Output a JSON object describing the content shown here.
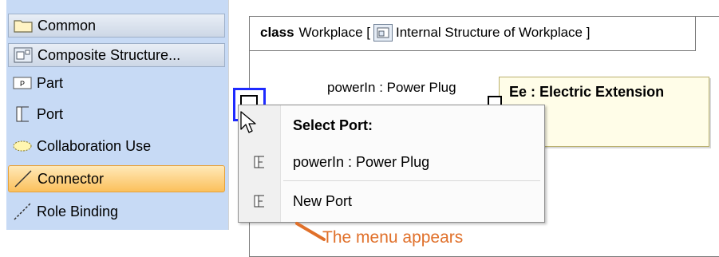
{
  "palette": {
    "items": [
      {
        "label": "Common",
        "icon": "folder-icon"
      },
      {
        "label": "Composite Structure...",
        "icon": "composite-structure-icon"
      },
      {
        "label": "Part",
        "icon": "part-icon"
      },
      {
        "label": "Port",
        "icon": "port-icon"
      },
      {
        "label": "Collaboration Use",
        "icon": "collaboration-use-icon"
      },
      {
        "label": "Connector",
        "icon": "connector-icon"
      },
      {
        "label": "Role Binding",
        "icon": "role-binding-icon"
      }
    ]
  },
  "diagram": {
    "frame_keyword": "class",
    "frame_name": "Workplace [",
    "frame_diagram_name": "Internal Structure of Workplace ]",
    "port_label": "powerIn : Power Plug",
    "part_label": "Ee : Electric Extension"
  },
  "menu": {
    "header": "Select Port:",
    "items": [
      {
        "label": "powerIn : Power Plug",
        "icon": "port-icon"
      },
      {
        "label": "New Port",
        "icon": "port-icon"
      }
    ]
  },
  "annotation": {
    "text": "The menu appears",
    "color": "#e0702a"
  },
  "colors": {
    "palette_bg": "#c7daf5",
    "selected_item": "#fbc05c",
    "selection_border": "#1e2aff",
    "part_fill": "#fffde8"
  }
}
